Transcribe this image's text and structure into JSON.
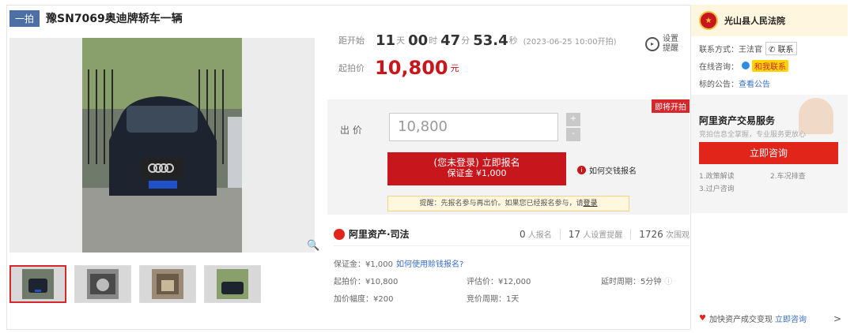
{
  "header": {
    "tag": "一拍",
    "title": "豫SN7069奥迪牌轿车一辆"
  },
  "countdown": {
    "label": "距开始",
    "days": "11",
    "days_unit": "天",
    "hours": "00",
    "hours_unit": "时",
    "minutes": "47",
    "minutes_unit": "分",
    "seconds": "53.4",
    "seconds_unit": "秒",
    "start": "(2023-06-25 10:00开拍)"
  },
  "reminder": {
    "line1": "设置",
    "line2": "提醒",
    "icon": "alarm-clock-icon"
  },
  "start_price": {
    "label": "起拍价",
    "value": "10,800",
    "unit": "元"
  },
  "bid": {
    "badge": "即将开拍",
    "label": "出  价",
    "value": "10,800",
    "plus": "+",
    "minus": "-",
    "signup_line1": "(您未登录) 立即报名",
    "signup_line2": "保证金 ¥1,000",
    "how_icon": "i",
    "how_label": "如何交钱报名",
    "tip_text": "提醒：先报名参与再出价。如果您已经报名参与，请",
    "tip_link": "登录"
  },
  "brand": {
    "name": "阿里资产·司法",
    "registered": "0",
    "registered_label": "人报名",
    "reminders": "17",
    "reminders_label": "人设置提醒",
    "views": "1726",
    "views_label": "次围观"
  },
  "details": {
    "deposit": "保证金：¥1,000",
    "deposit_link": "如何使用赊钱报名?",
    "start_price": "起拍价：¥10,800",
    "appraisal": "评估价：¥12,000",
    "delay": "延时周期：5分钟",
    "increment": "加价幅度：¥200",
    "bid_period": "竞价周期：1天"
  },
  "court": {
    "name": "光山县人民法院",
    "contact_label": "联系方式：",
    "contact_name": "王法官",
    "contact_btn": "联系",
    "online_label": "在线咨询：",
    "online_btn": "和我联系",
    "notice_label": "标的公告：",
    "notice_link": "查看公告"
  },
  "service": {
    "title": "阿里资产交易服务",
    "subtitle": "竞拍信息全掌握，专业服务更放心",
    "button": "立即咨询",
    "items": [
      "1.政策解读",
      "2.车况排查",
      "3.过户咨询"
    ]
  },
  "footer": {
    "text": "加快资产成交变现",
    "link": "立即咨询",
    "arrow": ">"
  },
  "gallery": {
    "thumb_count": 4,
    "zoom_icon": "magnifier-icon"
  }
}
